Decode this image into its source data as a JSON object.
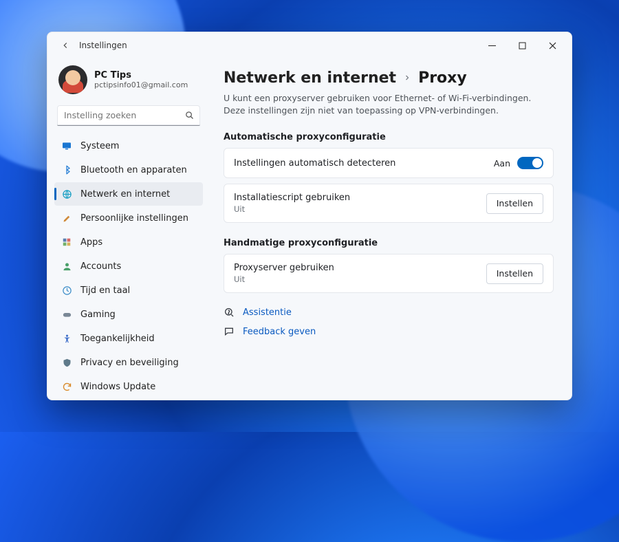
{
  "window": {
    "title": "Instellingen"
  },
  "user": {
    "name": "PC Tips",
    "email": "pctipsinfo01@gmail.com"
  },
  "search": {
    "placeholder": "Instelling zoeken"
  },
  "sidebar": {
    "items": [
      {
        "label": "Systeem"
      },
      {
        "label": "Bluetooth en apparaten"
      },
      {
        "label": "Netwerk en internet"
      },
      {
        "label": "Persoonlijke instellingen"
      },
      {
        "label": "Apps"
      },
      {
        "label": "Accounts"
      },
      {
        "label": "Tijd en taal"
      },
      {
        "label": "Gaming"
      },
      {
        "label": "Toegankelijkheid"
      },
      {
        "label": "Privacy en beveiliging"
      },
      {
        "label": "Windows Update"
      }
    ]
  },
  "main": {
    "breadcrumb": {
      "parent": "Netwerk en internet",
      "leaf": "Proxy"
    },
    "subtitle": "U kunt een proxyserver gebruiken voor Ethernet- of Wi-Fi-verbindingen. Deze instellingen zijn niet van toepassing op VPN-verbindingen.",
    "auto": {
      "heading": "Automatische proxyconfiguratie",
      "detect": {
        "title": "Instellingen automatisch detecteren",
        "state_label": "Aan"
      },
      "script": {
        "title": "Installatiescript gebruiken",
        "state": "Uit",
        "button": "Instellen"
      }
    },
    "manual": {
      "heading": "Handmatige proxyconfiguratie",
      "proxy": {
        "title": "Proxyserver gebruiken",
        "state": "Uit",
        "button": "Instellen"
      }
    },
    "links": {
      "help": "Assistentie",
      "feedback": "Feedback geven"
    }
  }
}
